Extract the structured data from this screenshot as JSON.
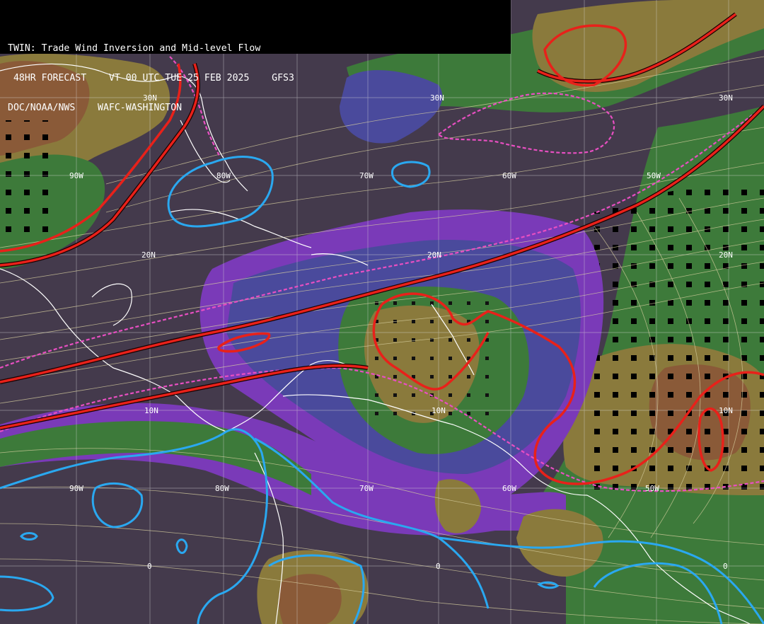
{
  "header": {
    "line1": "TWIN: Trade Wind Inversion and Mid-level Flow",
    "line2": " 48HR FORECAST    VT 00 UTC TUE 25 FEB 2025    GFS3",
    "line3": "DOC/NOAA/NWS    WAFC-WASHINGTON"
  },
  "grid_labels": {
    "lat_30n_a": "30N",
    "lat_30n_b": "30N",
    "lat_30n_c": "30N",
    "lat_20n_a": "20N",
    "lat_20n_b": "20N",
    "lat_20n_c": "20N",
    "lat_10n_a": "10N",
    "lat_10n_b": "10N",
    "lat_10n_c": "10N",
    "lat_0_a": "0",
    "lat_0_b": "0",
    "lat_0_c": "0",
    "lon_90w_a": "90W",
    "lon_80w_a": "80W",
    "lon_70w_a": "70W",
    "lon_60w_a": "60W",
    "lon_50w_a": "50W",
    "lon_90w_b": "90W",
    "lon_80w_b": "80W",
    "lon_70w_b": "70W",
    "lon_60w_b": "60W",
    "lon_50w_b": "50W"
  },
  "colors": {
    "background": "#443a4c",
    "purple_band": "#7a3ab8",
    "blue_band": "#4a4a9c",
    "green_band": "#3d7a3a",
    "olive_band": "#8a7a3c",
    "brown_band": "#8a5a38",
    "inversion_contour": "#e8211a",
    "magenta_dashed": "#e84fc2",
    "cyan_contour": "#2aa8f0",
    "streamline": "#d8d0a0",
    "coastline": "#ffffff"
  }
}
